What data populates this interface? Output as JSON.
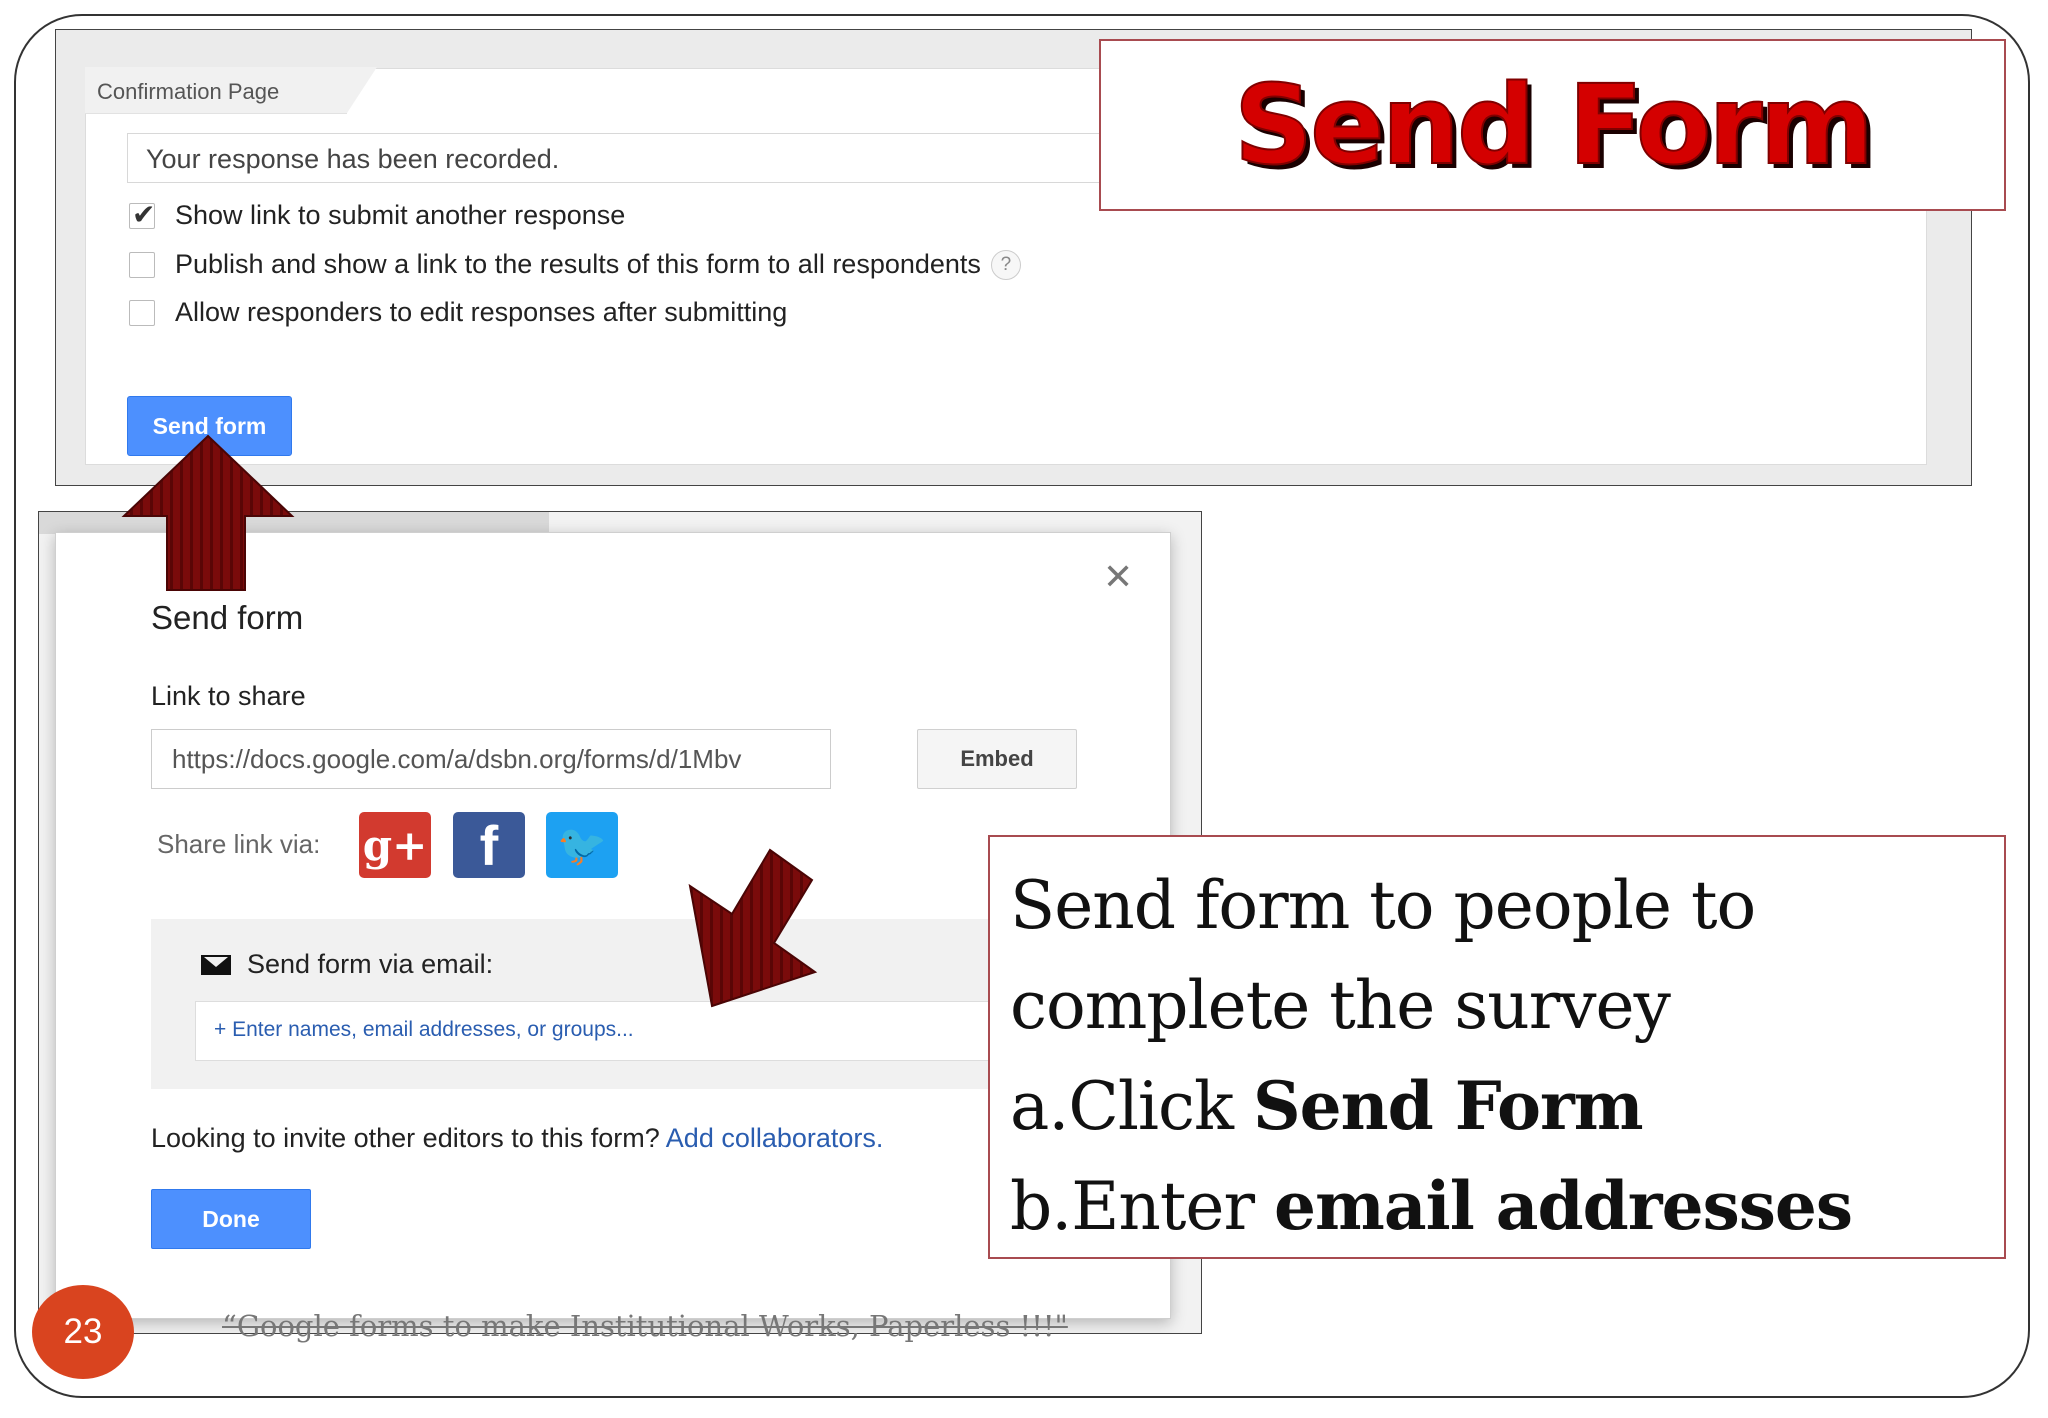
{
  "slide": {
    "title": "Send Form",
    "number": "23",
    "footer": "“Google forms to make Institutional Works, Paperless !!!\""
  },
  "confirmation": {
    "tab_label": "Confirmation Page",
    "message": "Your response has been recorded.",
    "options": [
      {
        "label": "Show link to submit another response",
        "checked": true
      },
      {
        "label": "Publish and show a link to the results of this form to all respondents",
        "checked": false
      },
      {
        "label": "Allow responders to edit responses after submitting",
        "checked": false
      }
    ],
    "help_glyph": "?",
    "send_button": "Send form"
  },
  "dialog": {
    "close_glyph": "✕",
    "title": "Send form",
    "link_label": "Link to share",
    "link_value": "https://docs.google.com/a/dsbn.org/forms/d/1Mbv",
    "embed_button": "Embed",
    "share_label": "Share link via:",
    "social": {
      "gplus": "g+",
      "facebook": "f",
      "twitter": "🐦"
    },
    "email_label": "Send form via email:",
    "email_placeholder": "+ Enter names, email addresses, or groups...",
    "collab_text": "Looking to invite other editors to this form?",
    "collab_link": "Add collaborators.",
    "done_button": "Done"
  },
  "instructions": {
    "line1": "Send form to people to",
    "line2": "complete the survey",
    "line3_prefix": "a.Click ",
    "line3_bold": "Send Form",
    "line4_prefix": "b.Enter ",
    "line4_bold": "email addresses"
  },
  "colors": {
    "accent_blue": "#4d90fe",
    "arrow": "#7a0b0b",
    "title_red": "#d40000",
    "badge": "#d9441f"
  }
}
